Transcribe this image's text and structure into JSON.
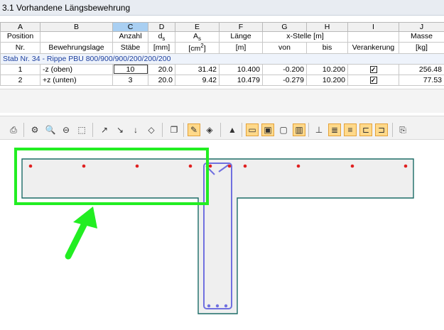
{
  "window": {
    "title": "3.1 Vorhandene Längsbewehrung"
  },
  "table": {
    "column_letters": [
      "A",
      "B",
      "C",
      "D",
      "E",
      "F",
      "G",
      "H",
      "I",
      "J"
    ],
    "header1": {
      "position": "Position",
      "anzahl": "Anzahl",
      "ds": "ds",
      "as": "As",
      "laenge": "Länge",
      "xstelle": "x-Stelle [m]",
      "masse": "Masse"
    },
    "header2": {
      "nr": "Nr.",
      "lage": "Bewehrungslage",
      "staebe": "Stäbe",
      "ds_unit": "[mm]",
      "as_unit": "[cm²]",
      "laenge_unit": "[m]",
      "von": "von",
      "bis": "bis",
      "verankerung": "Verankerung",
      "masse_unit": "[kg]"
    },
    "group_label": "Stab Nr. 34  -  Rippe PBU 800/900/900/200/200/200",
    "rows": [
      {
        "nr": "1",
        "lage": "-z (oben)",
        "staebe": "10",
        "ds": "20.0",
        "as": "31.42",
        "laenge": "10.400",
        "von": "-0.200",
        "bis": "10.200",
        "verankerung": "✓",
        "masse": "256.48"
      },
      {
        "nr": "2",
        "lage": "+z (unten)",
        "staebe": "3",
        "ds": "20.0",
        "as": "9.42",
        "laenge": "10.479",
        "von": "-0.279",
        "bis": "10.200",
        "verankerung": "✓",
        "masse": "77.53"
      }
    ]
  },
  "toolbar": {
    "icons": [
      "print-icon",
      "settings-icon",
      "zoom-icon",
      "zoom-out-icon",
      "select-icon",
      "view-x-icon",
      "view-minus-y-icon",
      "view-z-icon",
      "view-iso-icon",
      "copy-icon",
      "edit-section-icon",
      "render-icon",
      "color-icon",
      "section-full-icon",
      "section-top-icon",
      "section-frame-icon",
      "section-bars-icon",
      "axes-icon",
      "layers-icon",
      "layer-top-icon",
      "dimension-icon",
      "dimension-alt-icon",
      "export-icon"
    ]
  },
  "colors": {
    "section_outline": "#1b6b66",
    "section_fill": "#efefef",
    "stirrup": "#7070e0",
    "bar": "#e02020",
    "highlight": "#22ee22"
  }
}
